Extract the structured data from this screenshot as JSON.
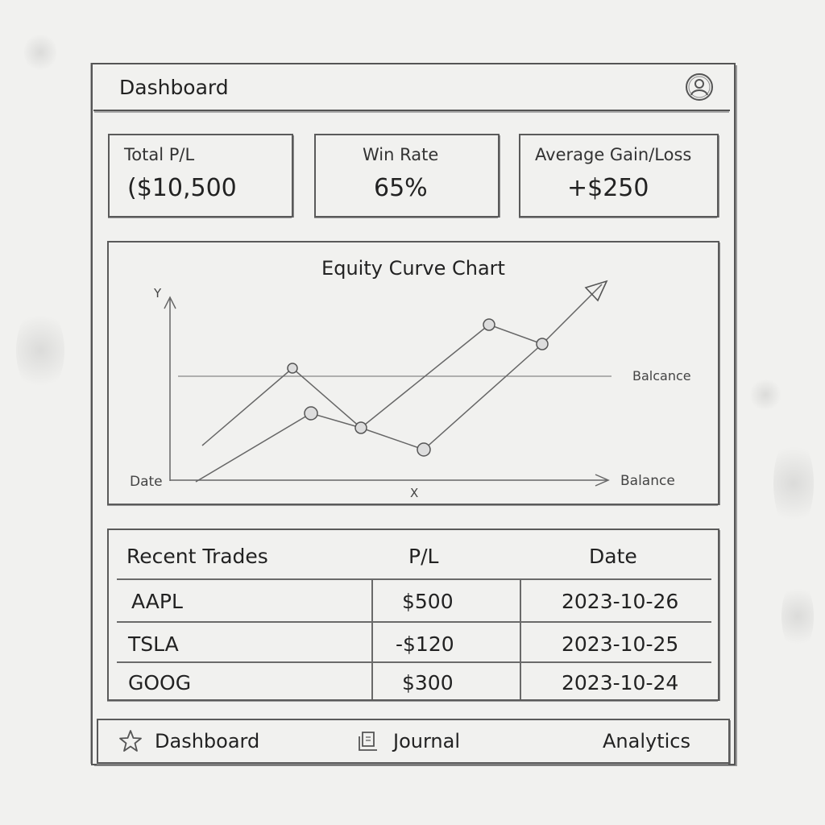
{
  "header": {
    "title": "Dashboard",
    "avatar_icon": "user-circle-icon"
  },
  "stats": [
    {
      "label": "Total P/L",
      "value": "($10,500"
    },
    {
      "label": "Win Rate",
      "value": "65%"
    },
    {
      "label": "Average Gain/Loss",
      "value": "+$250"
    }
  ],
  "chart": {
    "title": "Equity Curve Chart",
    "y_axis_label": "Y",
    "x_axis_label": "X",
    "origin_label": "Date",
    "x_end_label": "Balance",
    "reference_label": "Balcance"
  },
  "trades": {
    "headers": [
      "Recent Trades",
      "P/L",
      "Date"
    ],
    "rows": [
      {
        "symbol": "AAPL",
        "pl": "$500",
        "date": "2023-10-26"
      },
      {
        "symbol": "TSLA",
        "pl": "-$120",
        "date": "2023-10-25"
      },
      {
        "symbol": "GOOG",
        "pl": "$300",
        "date": "2023-10-24"
      }
    ]
  },
  "nav": [
    {
      "label": "Dashboard",
      "icon": "star-icon"
    },
    {
      "label": "Journal",
      "icon": "journal-icon"
    },
    {
      "label": "Analytics",
      "icon": ""
    }
  ],
  "colors": {
    "paper": "#f1f1ef",
    "pencil": "#555555"
  }
}
